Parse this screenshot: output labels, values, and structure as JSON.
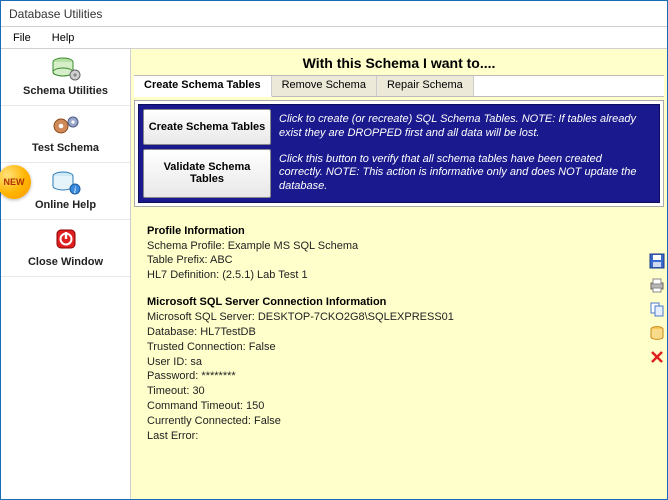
{
  "window": {
    "title": "Database Utilities"
  },
  "menu": {
    "file": "File",
    "help": "Help"
  },
  "sidebar": {
    "items": [
      {
        "label": "Schema Utilities"
      },
      {
        "label": "Test Schema"
      },
      {
        "label": "Online Help"
      },
      {
        "label": "Close Window"
      }
    ],
    "new_badge": "NEW"
  },
  "heading": "With this Schema I want to....",
  "tabs": [
    {
      "label": "Create Schema Tables"
    },
    {
      "label": "Remove Schema"
    },
    {
      "label": "Repair Schema"
    }
  ],
  "actions": {
    "create": {
      "button": "Create Schema Tables",
      "desc": "Click to create (or recreate) SQL Schema Tables. NOTE: If tables already exist they are DROPPED first and all data will be lost."
    },
    "validate": {
      "button": "Validate Schema Tables",
      "desc": "Click this button to verify that all schema tables have been created correctly. NOTE: This action is informative only and does NOT update the database."
    }
  },
  "profile": {
    "heading": "Profile Information",
    "lines": {
      "schema": "Schema Profile: Example MS SQL Schema",
      "prefix": "Table Prefix: ABC",
      "hl7def": "HL7 Definition: (2.5.1) Lab Test 1"
    }
  },
  "conn": {
    "heading": "Microsoft SQL Server Connection Information",
    "lines": {
      "server": "Microsoft SQL Server: DESKTOP-7CKO2G8\\SQLEXPRESS01",
      "database": "Database: HL7TestDB",
      "trusted": "Trusted Connection: False",
      "userid": "User ID: sa",
      "password": "Password: ********",
      "timeout": "Timeout: 30",
      "cmdtimeout": "Command Timeout: 150",
      "connected": "Currently Connected: False",
      "lasterror": "Last Error:"
    }
  }
}
